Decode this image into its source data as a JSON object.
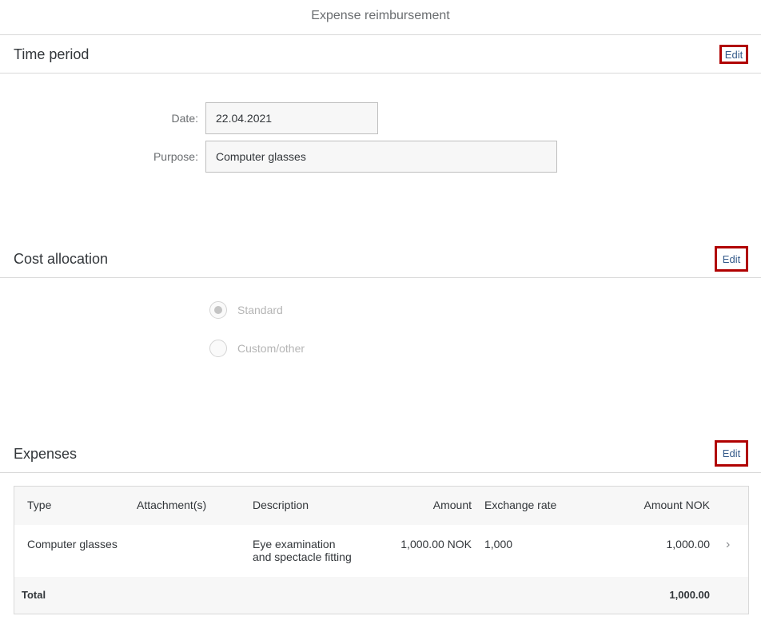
{
  "page": {
    "title": "Expense reimbursement"
  },
  "time_period": {
    "title": "Time period",
    "edit_label": "Edit",
    "date_label": "Date:",
    "date_value": "22.04.2021",
    "purpose_label": "Purpose:",
    "purpose_value": "Computer glasses"
  },
  "cost_allocation": {
    "title": "Cost allocation",
    "edit_label": "Edit",
    "options": [
      {
        "label": "Standard",
        "selected": true
      },
      {
        "label": "Custom/other",
        "selected": false
      }
    ]
  },
  "expenses": {
    "title": "Expenses",
    "edit_label": "Edit",
    "columns": [
      "Type",
      "Attachment(s)",
      "Description",
      "Amount",
      "Exchange rate",
      "Amount NOK"
    ],
    "rows": [
      {
        "type": "Computer glasses",
        "attachments": "",
        "description_line1": "Eye examination",
        "description_line2": "and spectacle fitting",
        "amount": "1,000.00 NOK",
        "exchange_rate": "1,000",
        "amount_nok": "1,000.00"
      }
    ],
    "total_label": "Total",
    "total_value": "1,000.00"
  },
  "colors": {
    "highlight_border": "#b00000",
    "link": "#345a8a"
  }
}
